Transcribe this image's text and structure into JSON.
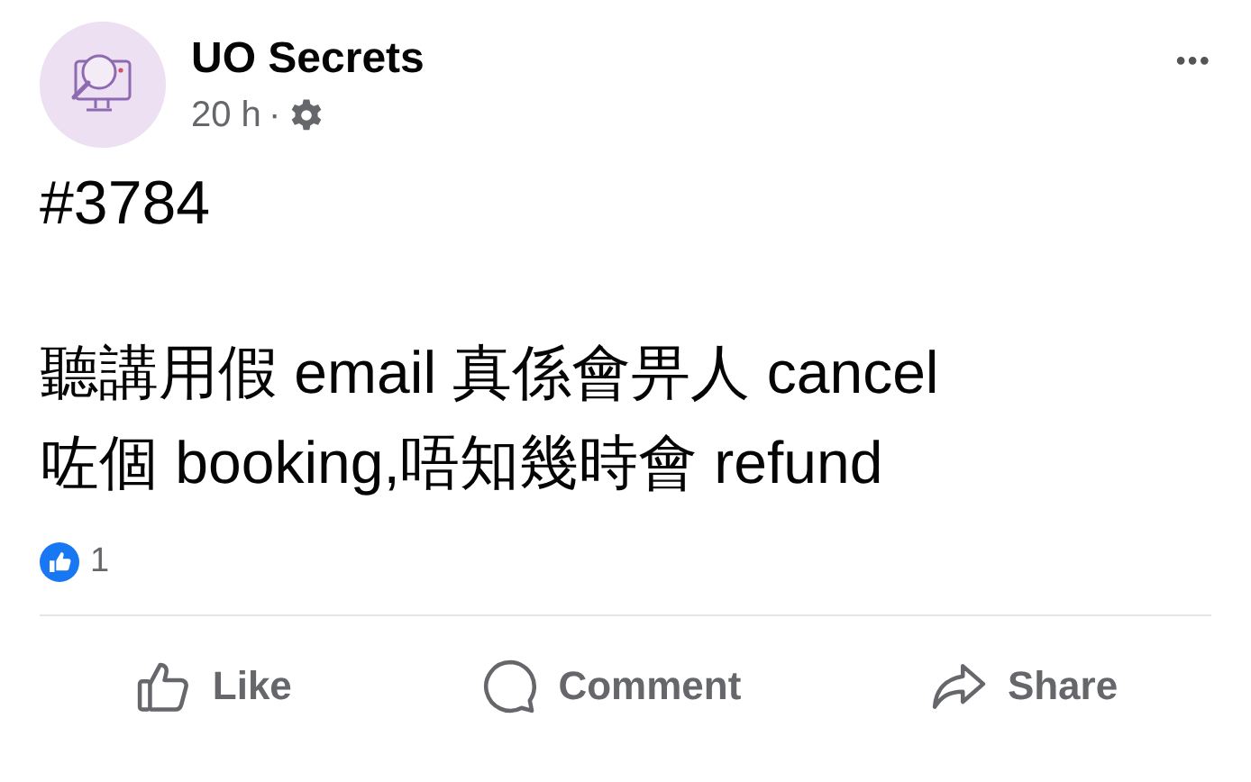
{
  "post": {
    "author": "UO Secrets",
    "time": "20 h",
    "separator": "·",
    "menu": "•••",
    "tag": "#3784",
    "body_lines": [
      "聽講用假 email 真係會畀人 cancel",
      "咗個 booking,唔知幾時會 refund"
    ],
    "reactions": {
      "count": "1"
    },
    "actions": [
      {
        "kind": "like",
        "label": "Like"
      },
      {
        "kind": "comment",
        "label": "Comment"
      },
      {
        "kind": "share",
        "label": "Share"
      }
    ]
  }
}
